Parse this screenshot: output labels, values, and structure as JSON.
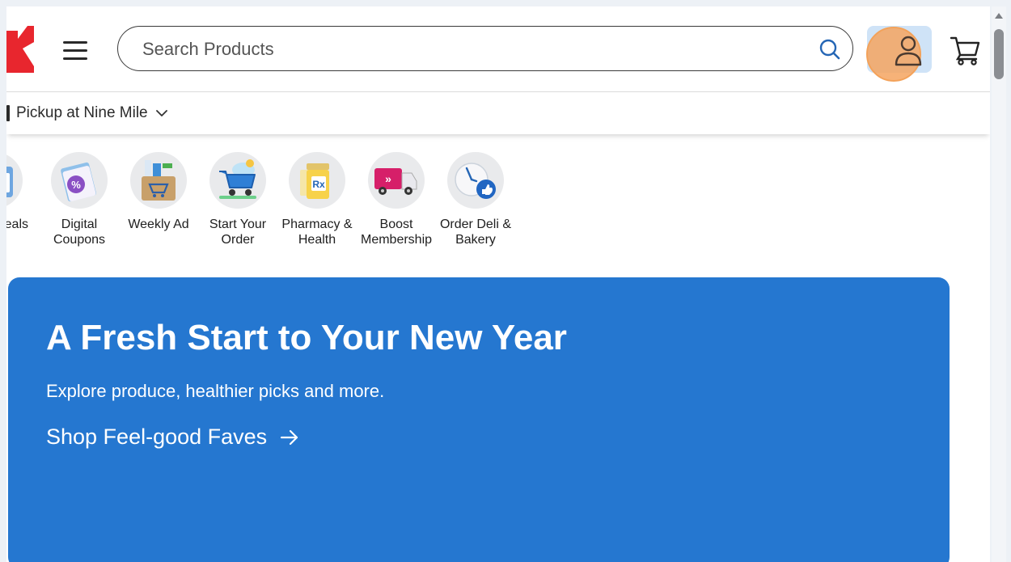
{
  "header": {
    "logo_name": "kroger-logo",
    "menu_icon": "hamburger-menu-icon",
    "search": {
      "placeholder": "Search Products",
      "value": ""
    },
    "account_icon": "user-icon",
    "cart_icon": "cart-icon",
    "brand_color": "#e8262e"
  },
  "pickup": {
    "label": "Pickup at Nine Mile"
  },
  "quick_links": [
    {
      "label": "eals",
      "icon": "deals-icon"
    },
    {
      "label": "Digital Coupons",
      "icon": "coupon-icon"
    },
    {
      "label": "Weekly Ad",
      "icon": "weekly-ad-icon"
    },
    {
      "label": "Start Your Order",
      "icon": "shopping-cart-icon"
    },
    {
      "label": "Pharmacy & Health",
      "icon": "pharmacy-icon"
    },
    {
      "label": "Boost Membership",
      "icon": "boost-truck-icon"
    },
    {
      "label": "Order Deli & Bakery",
      "icon": "deli-clock-icon"
    }
  ],
  "hero": {
    "title": "A Fresh Start to Your New Year",
    "subtitle": "Explore produce, healthier picks and more.",
    "link": "Shop Feel-good Faves",
    "background": "#2577d0"
  }
}
